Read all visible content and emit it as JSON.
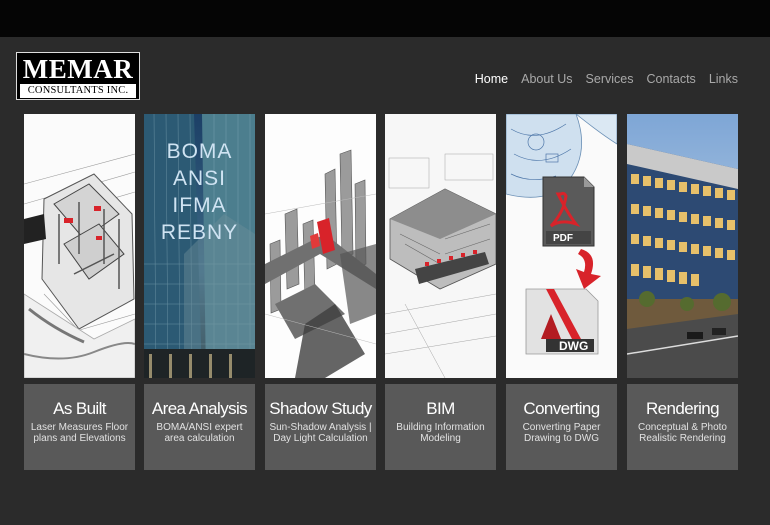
{
  "logo": {
    "name": "MEMAR",
    "subtitle": "CONSULTANTS INC."
  },
  "nav": [
    {
      "label": "Home",
      "active": true
    },
    {
      "label": "About Us",
      "active": false
    },
    {
      "label": "Services",
      "active": false
    },
    {
      "label": "Contacts",
      "active": false
    },
    {
      "label": "Links",
      "active": false
    }
  ],
  "panels": {
    "area_analysis_text": [
      "BOMA",
      "ANSI",
      "IFMA",
      "REBNY"
    ],
    "pdf_label": "PDF",
    "dwg_label": "DWG"
  },
  "services": [
    {
      "title": "As Built",
      "desc": "Laser Measures Floor plans and Elevations"
    },
    {
      "title": "Area Analysis",
      "desc": "BOMA/ANSI expert area calculation"
    },
    {
      "title": "Shadow Study",
      "desc": "Sun-Shadow Analysis | Day Light Calculation"
    },
    {
      "title": "BIM",
      "desc": "Building Information Modeling"
    },
    {
      "title": "Converting",
      "desc": "Converting Paper Drawing to DWG"
    },
    {
      "title": "Rendering",
      "desc": "Conceptual & Photo Realistic Rendering"
    }
  ],
  "colors": {
    "background": "#2b2b2b",
    "topbar": "#050505",
    "caption_bg": "#595959",
    "accent_red": "#d8232a"
  }
}
